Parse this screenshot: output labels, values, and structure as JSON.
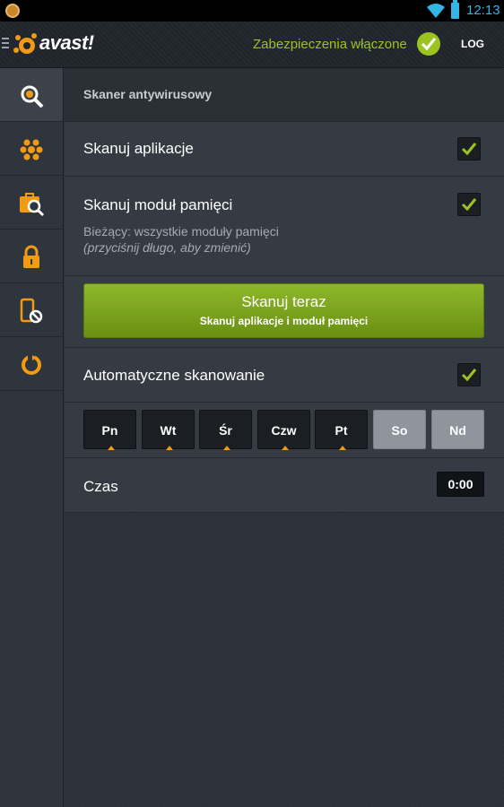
{
  "status_bar": {
    "time": "12:13"
  },
  "header": {
    "logo_text": "avast!",
    "protection_status": "Zabezpieczenia włączone",
    "log_label": "LOG"
  },
  "sidebar": {
    "items": [
      {
        "icon": "scan-icon",
        "active": true
      },
      {
        "icon": "shield-network-icon",
        "active": false
      },
      {
        "icon": "privacy-advisor-icon",
        "active": false
      },
      {
        "icon": "lock-icon",
        "active": false
      },
      {
        "icon": "call-filter-icon",
        "active": false
      },
      {
        "icon": "anti-theft-icon",
        "active": false
      }
    ]
  },
  "main": {
    "section_title": "Skaner antywirusowy",
    "scan_apps_label": "Skanuj aplikacje",
    "scan_memory_label": "Skanuj moduł pamięci",
    "memory_current": "Bieżący: wszystkie moduły pamięci",
    "memory_hint": "(przyciśnij długo, aby zmienić)",
    "scan_now_title": "Skanuj teraz",
    "scan_now_subtitle": "Skanuj aplikacje i moduł pamięci",
    "auto_scan_label": "Automatyczne skanowanie",
    "days": [
      {
        "label": "Pn",
        "selected": true
      },
      {
        "label": "Wt",
        "selected": true
      },
      {
        "label": "Śr",
        "selected": true
      },
      {
        "label": "Czw",
        "selected": true
      },
      {
        "label": "Pt",
        "selected": true
      },
      {
        "label": "So",
        "selected": false
      },
      {
        "label": "Nd",
        "selected": false
      }
    ],
    "time_label": "Czas",
    "time_value": "0:00"
  },
  "colors": {
    "accent_green": "#9cc421",
    "accent_orange": "#f29a12",
    "status_blue": "#33b5e5"
  }
}
